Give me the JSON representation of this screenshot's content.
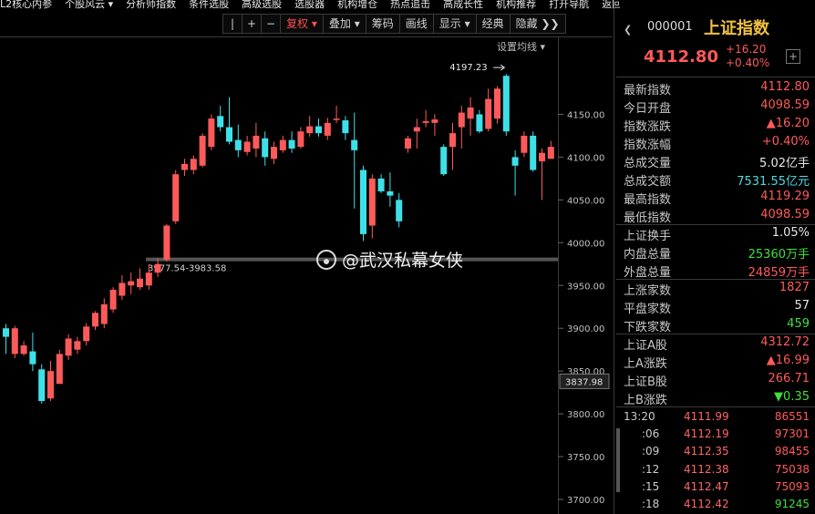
{
  "menu": [
    "L2核心内参",
    "个股风云",
    "分析师指数",
    "条件选股",
    "高级选股",
    "选股器",
    "机构增仓",
    "热点追击",
    "高成长性",
    "机构推荐",
    "打开导航",
    "返回"
  ],
  "toolbar": {
    "items": [
      "|",
      "+",
      "−",
      "复权",
      "叠加",
      "筹码",
      "画线",
      "显示",
      "经典",
      "隐藏"
    ],
    "setting_label": "设置均线"
  },
  "chart_data": {
    "type": "candlestick",
    "ylim": [
      3700,
      4200
    ],
    "y_ticks": [
      3700,
      3750,
      3800,
      3850,
      3900,
      3950,
      4000,
      4050,
      4100,
      4150
    ],
    "y_tick_labels": [
      "3700.00",
      "3750.00",
      "3800.00",
      "3850.00",
      "3900.00",
      "3950.00",
      "4000.00",
      "4050.00",
      "4100.00",
      "4150.00"
    ],
    "current_price_label": "3837.98",
    "current_price": 3837.98,
    "annotations": {
      "high_label": "4197.23",
      "high_value": 4197.23,
      "gap_label": "3977.54-3983.58",
      "gap_value": 3980.5
    },
    "candles": [
      {
        "o": 3900,
        "c": 3890,
        "h": 3905,
        "l": 3870
      },
      {
        "o": 3870,
        "c": 3900,
        "h": 3903,
        "l": 3865
      },
      {
        "o": 3870,
        "c": 3880,
        "h": 3885,
        "l": 3868
      },
      {
        "o": 3873,
        "c": 3858,
        "h": 3895,
        "l": 3850
      },
      {
        "o": 3852,
        "c": 3815,
        "h": 3858,
        "l": 3812
      },
      {
        "o": 3818,
        "c": 3850,
        "h": 3862,
        "l": 3815
      },
      {
        "o": 3835,
        "c": 3870,
        "h": 3875,
        "l": 3835
      },
      {
        "o": 3868,
        "c": 3888,
        "h": 3893,
        "l": 3863
      },
      {
        "o": 3875,
        "c": 3885,
        "h": 3890,
        "l": 3870
      },
      {
        "o": 3885,
        "c": 3902,
        "h": 3906,
        "l": 3880
      },
      {
        "o": 3902,
        "c": 3918,
        "h": 3920,
        "l": 3898
      },
      {
        "o": 3905,
        "c": 3928,
        "h": 3935,
        "l": 3900
      },
      {
        "o": 3922,
        "c": 3945,
        "h": 3948,
        "l": 3918
      },
      {
        "o": 3938,
        "c": 3953,
        "h": 3962,
        "l": 3933
      },
      {
        "o": 3950,
        "c": 3955,
        "h": 3965,
        "l": 3940
      },
      {
        "o": 3948,
        "c": 3958,
        "h": 3970,
        "l": 3945
      },
      {
        "o": 3950,
        "c": 3965,
        "h": 3975,
        "l": 3945
      },
      {
        "o": 3965,
        "c": 3975,
        "h": 3982,
        "l": 3960
      },
      {
        "o": 3980,
        "c": 4020,
        "h": 4022,
        "l": 3978
      },
      {
        "o": 4025,
        "c": 4080,
        "h": 4085,
        "l": 4022
      },
      {
        "o": 4085,
        "c": 4092,
        "h": 4098,
        "l": 4078
      },
      {
        "o": 4085,
        "c": 4098,
        "h": 4102,
        "l": 4080
      },
      {
        "o": 4090,
        "c": 4125,
        "h": 4128,
        "l": 4088
      },
      {
        "o": 4112,
        "c": 4145,
        "h": 4150,
        "l": 4108
      },
      {
        "o": 4148,
        "c": 4135,
        "h": 4160,
        "l": 4130
      },
      {
        "o": 4135,
        "c": 4118,
        "h": 4170,
        "l": 4115
      },
      {
        "o": 4120,
        "c": 4108,
        "h": 4138,
        "l": 4100
      },
      {
        "o": 4106,
        "c": 4118,
        "h": 4125,
        "l": 4102
      },
      {
        "o": 4110,
        "c": 4125,
        "h": 4140,
        "l": 4100
      },
      {
        "o": 4122,
        "c": 4100,
        "h": 4130,
        "l": 4090
      },
      {
        "o": 4098,
        "c": 4112,
        "h": 4118,
        "l": 4092
      },
      {
        "o": 4108,
        "c": 4120,
        "h": 4125,
        "l": 4105
      },
      {
        "o": 4120,
        "c": 4110,
        "h": 4130,
        "l": 4105
      },
      {
        "o": 4112,
        "c": 4130,
        "h": 4135,
        "l": 4110
      },
      {
        "o": 4128,
        "c": 4136,
        "h": 4148,
        "l": 4124
      },
      {
        "o": 4136,
        "c": 4128,
        "h": 4145,
        "l": 4124
      },
      {
        "o": 4125,
        "c": 4140,
        "h": 4146,
        "l": 4120
      },
      {
        "o": 4145,
        "c": 4145,
        "h": 4160,
        "l": 4140
      },
      {
        "o": 4143,
        "c": 4128,
        "h": 4148,
        "l": 4120
      },
      {
        "o": 4120,
        "c": 4108,
        "h": 4152,
        "l": 4040
      },
      {
        "o": 4085,
        "c": 4010,
        "h": 4090,
        "l": 4002
      },
      {
        "o": 4020,
        "c": 4075,
        "h": 4080,
        "l": 4005
      },
      {
        "o": 4075,
        "c": 4060,
        "h": 4080,
        "l": 4058
      },
      {
        "o": 4060,
        "c": 4055,
        "h": 4082,
        "l": 4042
      },
      {
        "o": 4050,
        "c": 4025,
        "h": 4058,
        "l": 4018
      },
      {
        "o": 4110,
        "c": 4122,
        "h": 4125,
        "l": 4105
      },
      {
        "o": 4130,
        "c": 4135,
        "h": 4145,
        "l": 4110
      },
      {
        "o": 4140,
        "c": 4142,
        "h": 4155,
        "l": 4135
      },
      {
        "o": 4140,
        "c": 4144,
        "h": 4150,
        "l": 4125
      },
      {
        "o": 4112,
        "c": 4080,
        "h": 4115,
        "l": 4078
      },
      {
        "o": 4112,
        "c": 4128,
        "h": 4140,
        "l": 4085
      },
      {
        "o": 4135,
        "c": 4152,
        "h": 4160,
        "l": 4110
      },
      {
        "o": 4145,
        "c": 4158,
        "h": 4170,
        "l": 4125
      },
      {
        "o": 4150,
        "c": 4130,
        "h": 4155,
        "l": 4128
      },
      {
        "o": 4133,
        "c": 4168,
        "h": 4180,
        "l": 4130
      },
      {
        "o": 4145,
        "c": 4180,
        "h": 4183,
        "l": 4139
      },
      {
        "o": 4195,
        "c": 4130,
        "h": 4197.23,
        "l": 4125
      },
      {
        "o": 4100,
        "c": 4090,
        "h": 4108,
        "l": 4055
      },
      {
        "o": 4105,
        "c": 4125,
        "h": 4130,
        "l": 4100
      },
      {
        "o": 4125,
        "c": 4085,
        "h": 4130,
        "l": 4083
      },
      {
        "o": 4095,
        "c": 4105,
        "h": 4110,
        "l": 4050
      },
      {
        "o": 4098,
        "c": 4112,
        "h": 4119,
        "l": 4098
      }
    ]
  },
  "header": {
    "code": "000001",
    "name": "上证指数",
    "price": "4112.80",
    "change": "+16.20",
    "change_pct": "+0.40%",
    "plus": "+"
  },
  "stats": [
    {
      "label": "最新指数",
      "value": "4112.80",
      "color": "#ff5a5a"
    },
    {
      "label": "今日开盘",
      "value": "4098.59",
      "color": "#ff5a5a"
    },
    {
      "label": "指数涨跌",
      "value": "▲16.20",
      "color": "#ff5a5a"
    },
    {
      "label": "指数涨幅",
      "value": "+0.40%",
      "color": "#ff5a5a"
    },
    {
      "label": "总成交量",
      "value": "5.02亿手",
      "color": "#e8e8e8"
    },
    {
      "label": "总成交额",
      "value": "7531.55亿元",
      "color": "#4fd8e0"
    },
    {
      "label": "最高指数",
      "value": "4119.29",
      "color": "#ff5a5a"
    },
    {
      "label": "最低指数",
      "value": "4098.59",
      "color": "#ff5a5a"
    }
  ],
  "stats2": [
    {
      "label": "上证换手",
      "value": "1.05%",
      "color": "#e8e8e8"
    },
    {
      "label": "内盘总量",
      "value": "25360万手",
      "color": "#3ee03e"
    },
    {
      "label": "外盘总量",
      "value": "24859万手",
      "color": "#ff5a5a"
    }
  ],
  "stats3": [
    {
      "label": "上涨家数",
      "value": "1827",
      "color": "#ff5a5a"
    },
    {
      "label": "平盘家数",
      "value": "57",
      "color": "#e8e8e8"
    },
    {
      "label": "下跌家数",
      "value": "459",
      "color": "#3ee03e"
    }
  ],
  "stats4": [
    {
      "label": "上证A股",
      "value": "4312.72",
      "color": "#ff5a5a"
    },
    {
      "label": "上A涨跌",
      "value": "▲16.99",
      "color": "#ff5a5a"
    },
    {
      "label": "上证B股",
      "value": "266.71",
      "color": "#ff5a5a"
    },
    {
      "label": "上B涨跌",
      "value": "▼0.35",
      "color": "#3ee03e"
    }
  ],
  "ticks": [
    {
      "time": "13:20",
      "price": "4111.99",
      "vol": "86551",
      "vcolor": "#ff5a5a"
    },
    {
      "time": ":06",
      "price": "4112.19",
      "vol": "97301",
      "vcolor": "#ff5a5a"
    },
    {
      "time": ":09",
      "price": "4112.35",
      "vol": "98455",
      "vcolor": "#ff5a5a"
    },
    {
      "time": ":12",
      "price": "4112.38",
      "vol": "75038",
      "vcolor": "#ff5a5a"
    },
    {
      "time": ":15",
      "price": "4112.47",
      "vol": "75093",
      "vcolor": "#ff5a5a"
    },
    {
      "time": ":18",
      "price": "4112.42",
      "vol": "91245",
      "vcolor": "#3ee03e"
    }
  ],
  "watermark": "@武汉私幕女侠",
  "colors": {
    "up": "#ff5a5a",
    "down": "#3ee0e8",
    "grid": "#3a3a3a",
    "axis_text": "#c0c0c0"
  }
}
